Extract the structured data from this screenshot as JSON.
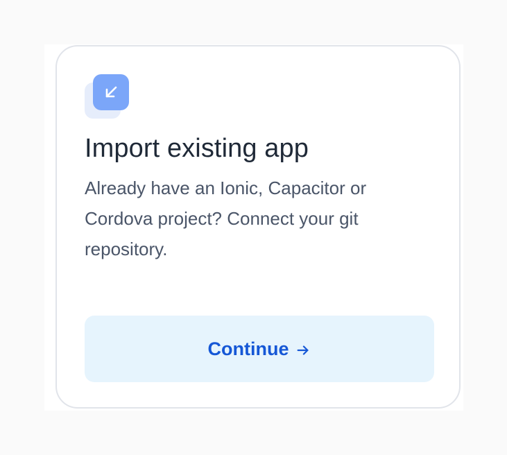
{
  "card": {
    "icon": "arrow-down-left-icon",
    "title": "Import existing app",
    "description": "Already have an Ionic, Capacitor or Cordova project? Connect your git repository.",
    "button": {
      "label": "Continue",
      "icon": "arrow-right-icon"
    }
  },
  "colors": {
    "page_background": "#fafafa",
    "card_border": "#e1e4ea",
    "icon_tile": "#7ba6f9",
    "icon_tile_shadow": "#e6edfb",
    "title_text": "#1f2937",
    "body_text": "#4a5568",
    "button_background": "#e6f4fd",
    "button_text": "#1557d6"
  }
}
